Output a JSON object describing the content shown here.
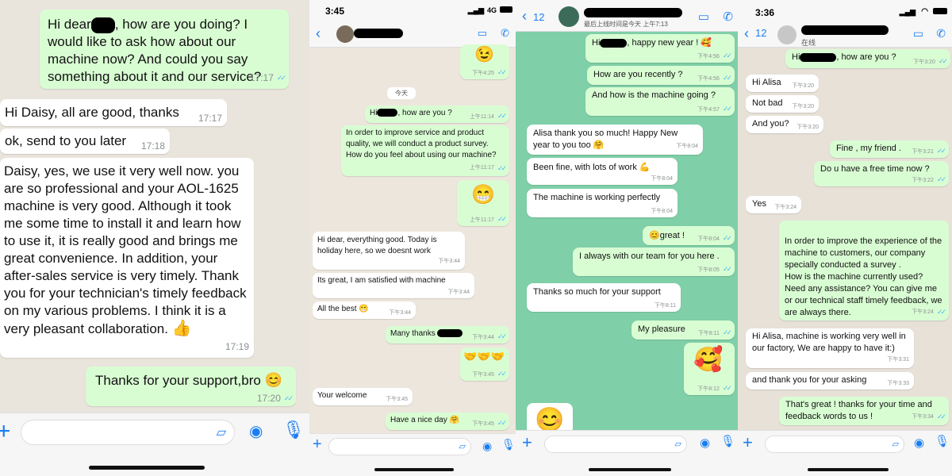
{
  "panel1": {
    "messages": [
      {
        "dir": "out",
        "pre": "Hi dear",
        "post": ", how are you doing? I would like to ask how about our machine now? And could you say something about it and our service?",
        "time": "17:17",
        "ticks": true
      },
      {
        "dir": "in",
        "text": "Hi Daisy,  all are good, thanks",
        "time": "17:17"
      },
      {
        "dir": "in",
        "text": "ok, send to you later",
        "time": "17:18"
      },
      {
        "dir": "in",
        "text": "Daisy,  yes, we use it very well now. you are so professional and your AOL-1625 machine is very good. Although it took me some time to install it and learn how to use it, it is really good and brings me great convenience. In addition, your after-sales service is very timely. Thank you for your technician's timely feedback on my various problems. I think it is a very pleasant collaboration.",
        "emoji": "👍",
        "time": "17:19"
      },
      {
        "dir": "out",
        "text": "Thanks for your support,bro",
        "emoji": "😊",
        "time": "17:20",
        "ticks": true
      }
    ]
  },
  "panel2": {
    "status_time": "3:45",
    "status_network": "4G",
    "day_label": "今天",
    "messages": [
      {
        "dir": "out",
        "emoji": "😉",
        "time": "下午4:25",
        "ticks": true
      },
      {
        "dir": "out",
        "pre": "Hi",
        "post": ", how are you ?",
        "time": "上午11:14",
        "ticks": true
      },
      {
        "dir": "out",
        "text": "In order to improve service and product quality, we will conduct a product survey. How do you feel about using our machine?",
        "time": "上午11:17",
        "ticks": true
      },
      {
        "dir": "out",
        "emoji": "😁",
        "time": "上午11:17",
        "ticks": true
      },
      {
        "dir": "in",
        "text": "Hi dear, everything good. Today is holiday here, so we doesnt work",
        "time": "下午3:44"
      },
      {
        "dir": "in",
        "text": "Its great, I am satisfied with machine",
        "time": "下午3:44"
      },
      {
        "dir": "in",
        "text": "All the best",
        "emoji": "😁",
        "time": "下午3:44"
      },
      {
        "dir": "out",
        "text": "Many thanks",
        "time": "下午3:44",
        "ticks": true
      },
      {
        "dir": "out",
        "emoji": "🤝🤝🤝",
        "time": "下午3:45",
        "ticks": true
      },
      {
        "dir": "in",
        "text": "Your welcome",
        "time": "下午3:45"
      },
      {
        "dir": "out",
        "text": "Have a nice day",
        "emoji": "🤗",
        "time": "下午3:45",
        "ticks": true
      }
    ]
  },
  "panel3": {
    "back_count": "12",
    "last_seen": "最后上线时间是今天 上午7:13",
    "messages": [
      {
        "dir": "out",
        "pre": "Hi",
        "post": ", happy new year !",
        "emoji": "🥰",
        "time": "下午4:56",
        "ticks": true
      },
      {
        "dir": "out",
        "text": "How are you recently ?",
        "time": "下午4:56",
        "ticks": true
      },
      {
        "dir": "out",
        "text": "And how is the machine going ?",
        "time": "下午4:57",
        "ticks": true
      },
      {
        "dir": "in",
        "text": "Alisa thank you so much! Happy New year to you too",
        "emoji": "🤗",
        "time": "下午8:04"
      },
      {
        "dir": "in",
        "text": "Been fine, with lots of work",
        "emoji": "💪",
        "time": "下午8:04"
      },
      {
        "dir": "in",
        "text": "The machine is working perfectly",
        "time": "下午8:04"
      },
      {
        "dir": "out",
        "emoji": "😊",
        "text": "great !",
        "time": "下午8:04",
        "ticks": true
      },
      {
        "dir": "out",
        "text": "I always with our team for you here .",
        "time": "下午8:05",
        "ticks": true
      },
      {
        "dir": "in",
        "text": "Thanks so much for your support",
        "time": "下午8:11"
      },
      {
        "dir": "out",
        "text": "My pleasure",
        "time": "下午8:11",
        "ticks": true
      },
      {
        "dir": "out",
        "emoji": "🥰",
        "time": "下午8:12",
        "ticks": true
      },
      {
        "dir": "in",
        "emoji": "😊"
      }
    ]
  },
  "panel4": {
    "status_time": "3:36",
    "back_count": "12",
    "presence": "在线",
    "messages": [
      {
        "dir": "out",
        "pre": "Hi",
        "post": ", how are you ?",
        "time": "下午3:20",
        "ticks": true
      },
      {
        "dir": "in",
        "text": "Hi Alisa",
        "time": "下午3:20"
      },
      {
        "dir": "in",
        "text": "Not bad",
        "time": "下午3:20"
      },
      {
        "dir": "in",
        "text": "And you?",
        "time": "下午3:20"
      },
      {
        "dir": "out",
        "text": "Fine , my friend .",
        "time": "下午3:21",
        "ticks": true
      },
      {
        "dir": "out",
        "text": "Do u have a free time now ?",
        "time": "下午3:22",
        "ticks": true
      },
      {
        "dir": "in",
        "text": "Yes",
        "time": "下午3:24"
      },
      {
        "dir": "out",
        "text": "In order to improve the experience of the machine to customers, our company specially conducted a survey .\nHow is the machine currently used?\nNeed any assistance? You can give me or our technical staff timely feedback, we are always there.",
        "time": "下午3:24",
        "ticks": true
      },
      {
        "dir": "in",
        "text": "Hi Alisa, machine is working very well in our factory,  We are happy to have it:)",
        "time": "下午3:31"
      },
      {
        "dir": "in",
        "text": "and thank you for your asking",
        "time": "下午3:33"
      },
      {
        "dir": "out",
        "text": "That's great ! thanks for your time and feedback words to us !",
        "time": "下午3:34",
        "ticks": true
      }
    ]
  }
}
